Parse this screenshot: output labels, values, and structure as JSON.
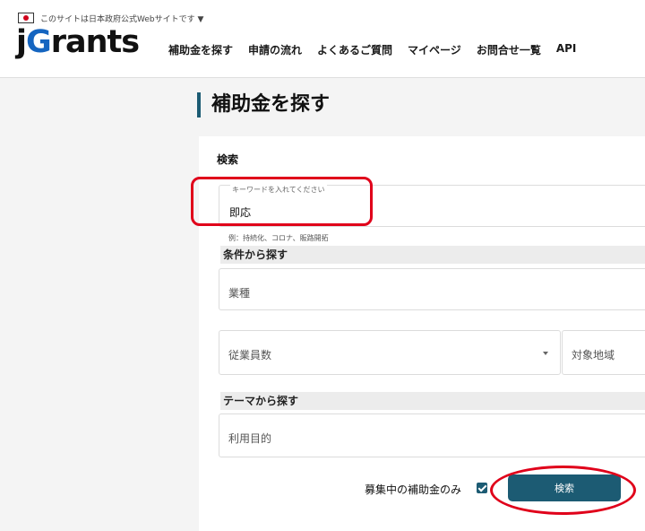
{
  "header": {
    "gov_banner": "このサイトは日本政府公式Webサイトです ▼",
    "logo": "jGrants",
    "nav": [
      "補助金を探す",
      "申請の流れ",
      "よくあるご質問",
      "マイページ",
      "お問合せ一覧",
      "API"
    ]
  },
  "page": {
    "title": "補助金を探す"
  },
  "search_card": {
    "heading": "検索",
    "keyword": {
      "label": "キーワードを入れてください",
      "value": "即応",
      "hint": "例：持続化、コロナ、販路開拓"
    },
    "conditions": {
      "section_label": "条件から探す",
      "industry_placeholder": "業種",
      "employees_placeholder": "従業員数",
      "region_placeholder": "対象地域"
    },
    "theme": {
      "section_label": "テーマから探す",
      "purpose_placeholder": "利用目的"
    },
    "open_only_label": "募集中の補助金のみ",
    "open_only_checked": true,
    "search_button": "検索"
  },
  "colors": {
    "primary": "#1c5b73",
    "annotation_red": "#e0001a",
    "logo_accent": "#1565c0"
  }
}
